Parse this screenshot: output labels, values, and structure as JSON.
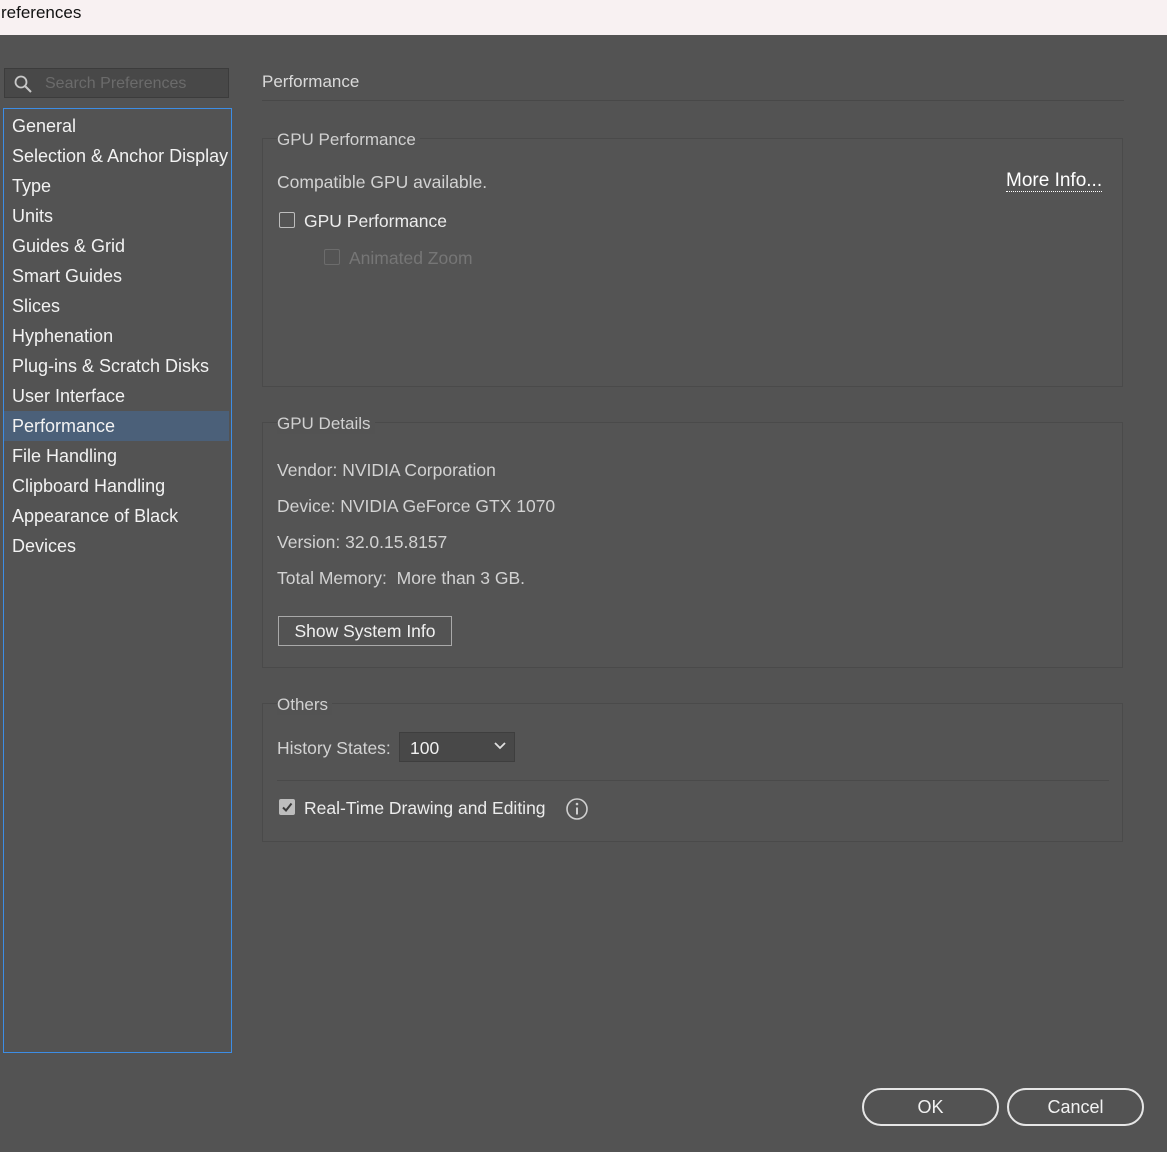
{
  "window": {
    "title": "references"
  },
  "search": {
    "placeholder": "Search Preferences",
    "value": ""
  },
  "sidebar": {
    "items": [
      {
        "label": "General"
      },
      {
        "label": "Selection & Anchor Display"
      },
      {
        "label": "Type"
      },
      {
        "label": "Units"
      },
      {
        "label": "Guides & Grid"
      },
      {
        "label": "Smart Guides"
      },
      {
        "label": "Slices"
      },
      {
        "label": "Hyphenation"
      },
      {
        "label": "Plug-ins & Scratch Disks"
      },
      {
        "label": "User Interface"
      },
      {
        "label": "Performance"
      },
      {
        "label": "File Handling"
      },
      {
        "label": "Clipboard Handling"
      },
      {
        "label": "Appearance of Black"
      },
      {
        "label": "Devices"
      }
    ],
    "selected": "Performance"
  },
  "main": {
    "title": "Performance",
    "gpu_performance": {
      "title": "GPU Performance",
      "status": "Compatible GPU available.",
      "more_info": "More Info...",
      "gpu_checkbox": {
        "label": "GPU Performance",
        "checked": false
      },
      "animated_zoom": {
        "label": "Animated Zoom",
        "checked": false,
        "disabled": true
      }
    },
    "gpu_details": {
      "title": "GPU Details",
      "vendor": "Vendor: NVIDIA Corporation",
      "device": "Device: NVIDIA GeForce GTX 1070",
      "version": "Version: 32.0.15.8157",
      "memory": "Total Memory:  More than 3 GB.",
      "show_system_info": "Show System Info"
    },
    "others": {
      "title": "Others",
      "history_label": "History States:",
      "history_value": "100",
      "realtime": {
        "label": "Real-Time Drawing and Editing",
        "checked": true
      }
    }
  },
  "buttons": {
    "ok": "OK",
    "cancel": "Cancel"
  }
}
